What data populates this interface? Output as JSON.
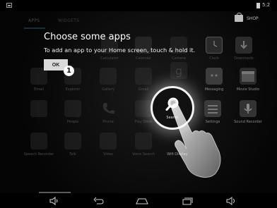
{
  "status": {
    "time": "5:2"
  },
  "tabs": [
    {
      "label": "APPS"
    },
    {
      "label": "WIDGETS"
    }
  ],
  "shop": {
    "label": "SHOP"
  },
  "apps": [
    {
      "label": "Calculator"
    },
    {
      "label": "Calendar"
    },
    {
      "label": "Camera"
    },
    {
      "label": "Clock"
    },
    {
      "label": "Downloads"
    },
    {
      "label": "Email"
    },
    {
      "label": "Explorer"
    },
    {
      "label": "Gallery"
    },
    {
      "label": "Gmail"
    },
    {
      "label": "Messaging"
    },
    {
      "label": "Movie Studio"
    },
    {
      "label": "People"
    },
    {
      "label": "Phone"
    },
    {
      "label": "Play Store"
    },
    {
      "label": "Search"
    },
    {
      "label": "Settings"
    },
    {
      "label": "Sound Recorder"
    },
    {
      "label": "Speech Recorder"
    },
    {
      "label": "Talk"
    },
    {
      "label": "Video"
    },
    {
      "label": "Voice Search"
    },
    {
      "label": "Wifi Display"
    }
  ],
  "overlay": {
    "title": "Choose some apps",
    "subtitle": "To add an app to your Home screen, touch & hold it.",
    "ok_label": "OK",
    "callout_number": "1"
  },
  "colors": {
    "overlay_text": "#ffffff",
    "spotlight": "#f2f2f2",
    "nav_icon": "#cfcfcf"
  },
  "nav": [
    "volume-down-icon",
    "back-icon",
    "home-icon",
    "recent-apps-icon",
    "volume-up-icon"
  ]
}
